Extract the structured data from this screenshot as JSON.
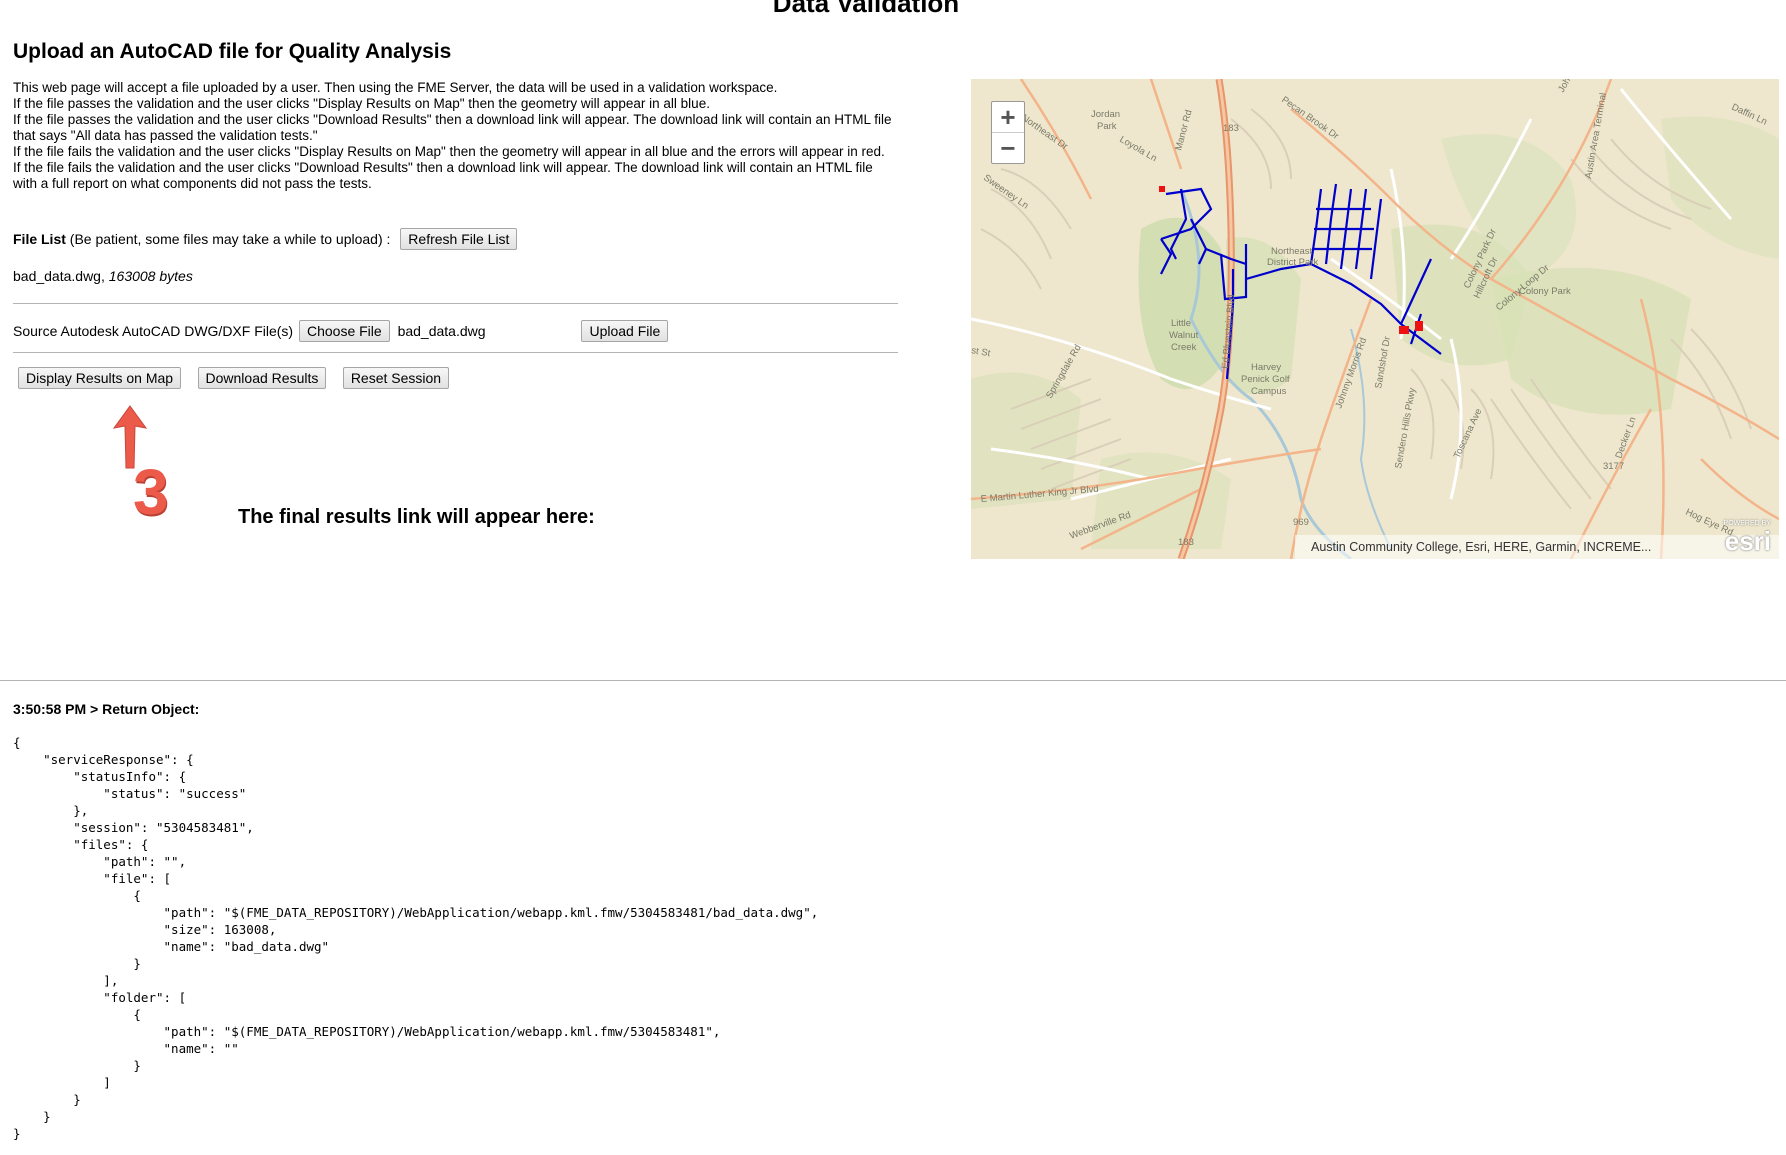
{
  "page": {
    "title": "Data Validation",
    "heading": "Upload an AutoCAD file for Quality Analysis",
    "description": [
      "This web page will accept a file uploaded by a user. Then using the FME Server, the data will be used in a validation workspace.",
      "If the file passes the validation and the user clicks \"Display Results on Map\" then the geometry will appear in all blue.",
      "If the file passes the validation and the user clicks \"Download Results\" then a download link will appear. The download link will contain an HTML file that says \"All data has passed the validation tests.\"",
      "If the file fails the validation and the user clicks \"Display Results on Map\" then the geometry will appear in all blue and the errors will appear in red.",
      "If the file fails the validation and the user clicks \"Download Results\" then a download link will appear. The download link will contain an HTML file with a full report on what components did not pass the tests."
    ]
  },
  "file_list": {
    "label": "File List",
    "hint": "(Be patient, some files may take a while to upload) :",
    "refresh_label": "Refresh File List",
    "file_name": "bad_data.dwg,",
    "file_size": "163008 bytes"
  },
  "source": {
    "label": "Source Autodesk AutoCAD DWG/DXF File(s)",
    "choose_label": "Choose File",
    "chosen_file": "bad_data.dwg",
    "upload_label": "Upload File"
  },
  "actions": {
    "display_label": "Display Results on Map",
    "download_label": "Download Results",
    "reset_label": "Reset Session"
  },
  "annotation": {
    "step_number": "3",
    "arrow_color": "#ec5a4a"
  },
  "results": {
    "label": "The final results link will appear here:"
  },
  "map": {
    "zoom_in": "+",
    "zoom_out": "−",
    "attribution": "Austin Community College, Esri, HERE, Garmin, INCREME...",
    "logo_small": "POWERED BY",
    "logo": "esri",
    "labels": [
      "Jordan",
      "Park",
      "Loyola Ln",
      "Manor Rd",
      "183",
      "Pecan Brook Dr",
      "Daffin Ln",
      "Austin Area Terminal",
      "Northeast Dr",
      "Sweeney Ln",
      "Northeast",
      "District Park",
      "Colony Park Dr",
      "Hillcroft Dr",
      "Colony Loop Dr",
      "Colony Park",
      "Little",
      "Walnut",
      "Creek",
      "Ed Bluestein Blvd",
      "Harvey",
      "Penick Golf",
      "Campus",
      "Springdale Rd",
      "Johnny Morris Rd",
      "Sandshof Dr",
      "Sendero Hills Pkwy",
      "Toscana Ave",
      "Decker Ln",
      "3177",
      "E Martin Luther King Jr Blvd",
      "Webberville Rd",
      "969",
      "183",
      "Hog Eye Rd",
      "st St",
      "John"
    ],
    "line_color": "#0000cc",
    "error_color": "#ee1111"
  },
  "log": {
    "header": "3:50:58 PM > Return Object:",
    "json": "{\n    \"serviceResponse\": {\n        \"statusInfo\": {\n            \"status\": \"success\"\n        },\n        \"session\": \"5304583481\",\n        \"files\": {\n            \"path\": \"\",\n            \"file\": [\n                {\n                    \"path\": \"$(FME_DATA_REPOSITORY)/WebApplication/webapp.kml.fmw/5304583481/bad_data.dwg\",\n                    \"size\": 163008,\n                    \"name\": \"bad_data.dwg\"\n                }\n            ],\n            \"folder\": [\n                {\n                    \"path\": \"$(FME_DATA_REPOSITORY)/WebApplication/webapp.kml.fmw/5304583481\",\n                    \"name\": \"\"\n                }\n            ]\n        }\n    }\n}"
  }
}
